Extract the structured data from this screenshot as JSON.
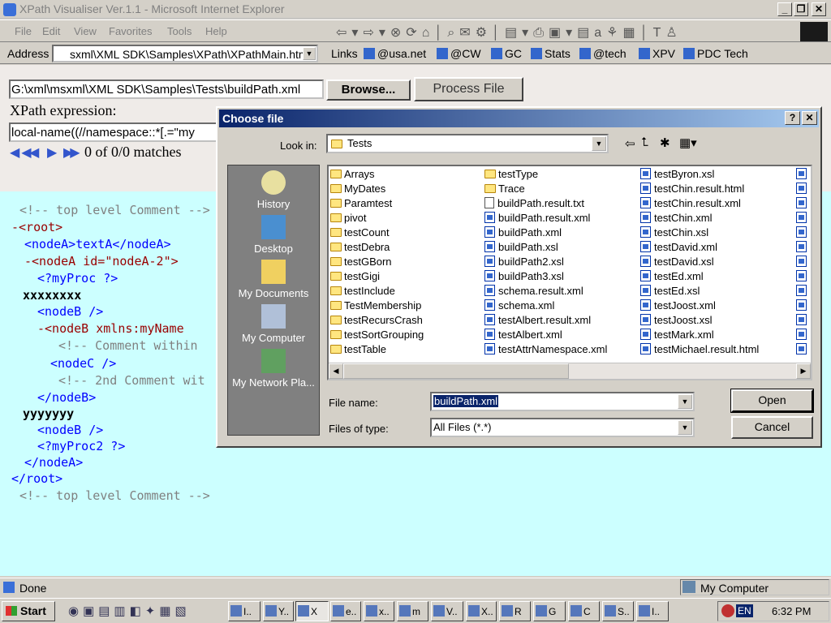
{
  "window": {
    "title": "XPath Visualiser Ver.1.1 - Microsoft Internet Explorer"
  },
  "menu": [
    "File",
    "Edit",
    "View",
    "Favorites",
    "Tools",
    "Help"
  ],
  "address": {
    "label": "Address",
    "value": "sxml\\XML SDK\\Samples\\XPath\\XPathMain.htm"
  },
  "links": {
    "label": "Links",
    "items": [
      "@usa.net",
      "@CW",
      "GC",
      "Stats",
      "@tech",
      "XPV",
      "PDC Tech"
    ]
  },
  "form": {
    "file_path": "G:\\xml\\msxml\\XML SDK\\Samples\\Tests\\buildPath.xml",
    "browse_label": "Browse...",
    "process_label": "Process File",
    "xpath_label": "XPath expression:",
    "xpath_value": "local-name((//namespace::*[.=\"my",
    "matches_text": "0 of 0/0 matches"
  },
  "xml": [
    "<!-- top level Comment -->",
    "-<root>",
    "<nodeA>textA</nodeA>",
    "-<nodeA id=\"nodeA-2\">",
    "<?myProc ?>",
    "xxxxxxxx",
    "<nodeB />",
    "-<nodeB xmlns:myName",
    "<!-- Comment within",
    "<nodeC />",
    "<!-- 2nd Comment wit",
    "</nodeB>",
    "yyyyyyy",
    "<nodeB />",
    "<?myProc2 ?>",
    "</nodeA>",
    "</root>",
    "<!-- top level Comment -->"
  ],
  "dialog": {
    "title": "Choose file",
    "look_in_label": "Look in:",
    "look_in_value": "Tests",
    "places": [
      "History",
      "Desktop",
      "My Documents",
      "My Computer",
      "My Network Pla..."
    ],
    "col1": [
      {
        "name": "Arrays",
        "type": "folder"
      },
      {
        "name": "MyDates",
        "type": "folder"
      },
      {
        "name": "Paramtest",
        "type": "folder"
      },
      {
        "name": "pivot",
        "type": "folder"
      },
      {
        "name": "testCount",
        "type": "folder"
      },
      {
        "name": "testDebra",
        "type": "folder"
      },
      {
        "name": "testGBorn",
        "type": "folder"
      },
      {
        "name": "testGigi",
        "type": "folder"
      },
      {
        "name": "testInclude",
        "type": "folder"
      },
      {
        "name": "TestMembership",
        "type": "folder"
      },
      {
        "name": "testRecursCrash",
        "type": "folder"
      },
      {
        "name": "testSortGrouping",
        "type": "folder"
      },
      {
        "name": "testTable",
        "type": "folder"
      }
    ],
    "col2": [
      {
        "name": "testType",
        "type": "folder"
      },
      {
        "name": "Trace",
        "type": "folder"
      },
      {
        "name": "buildPath.result.txt",
        "type": "txt"
      },
      {
        "name": "buildPath.result.xml",
        "type": "xml"
      },
      {
        "name": "buildPath.xml",
        "type": "xml"
      },
      {
        "name": "buildPath.xsl",
        "type": "xml"
      },
      {
        "name": "buildPath2.xsl",
        "type": "xml"
      },
      {
        "name": "buildPath3.xsl",
        "type": "xml"
      },
      {
        "name": "schema.result.xml",
        "type": "xml"
      },
      {
        "name": "schema.xml",
        "type": "xml"
      },
      {
        "name": "testAlbert.result.xml",
        "type": "xml"
      },
      {
        "name": "testAlbert.xml",
        "type": "xml"
      },
      {
        "name": "testAttrNamespace.xml",
        "type": "xml"
      }
    ],
    "col3": [
      {
        "name": "testByron.xsl",
        "type": "xml"
      },
      {
        "name": "testChin.result.html",
        "type": "xml"
      },
      {
        "name": "testChin.result.xml",
        "type": "xml"
      },
      {
        "name": "testChin.xml",
        "type": "xml"
      },
      {
        "name": "testChin.xsl",
        "type": "xml"
      },
      {
        "name": "testDavid.xml",
        "type": "xml"
      },
      {
        "name": "testDavid.xsl",
        "type": "xml"
      },
      {
        "name": "testEd.xml",
        "type": "xml"
      },
      {
        "name": "testEd.xsl",
        "type": "xml"
      },
      {
        "name": "testJoost.xml",
        "type": "xml"
      },
      {
        "name": "testJoost.xsl",
        "type": "xml"
      },
      {
        "name": "testMark.xml",
        "type": "xml"
      },
      {
        "name": "testMichael.result.html",
        "type": "xml"
      }
    ],
    "file_name_label": "File name:",
    "file_name_value": "buildPath.xml",
    "files_of_type_label": "Files of type:",
    "files_of_type_value": "All Files (*.*)",
    "open_label": "Open",
    "cancel_label": "Cancel"
  },
  "status": {
    "text": "Done",
    "zone": "My Computer"
  },
  "taskbar": {
    "start": "Start",
    "tasks": [
      "I..",
      "Y..",
      "X",
      "e..",
      "x..",
      "m",
      "V..",
      "X..",
      "R",
      "G",
      "C",
      "S..",
      "I.."
    ],
    "lang": "EN",
    "clock": "6:32 PM"
  }
}
